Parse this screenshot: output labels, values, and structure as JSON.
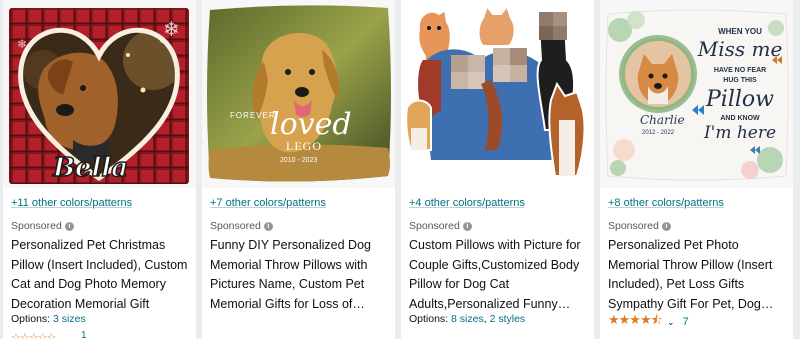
{
  "products": [
    {
      "colors_link": "+11 other colors/patterns",
      "sponsored": "Sponsored",
      "title": "Personalized Pet Christmas Pillow (Insert Included), Custom Cat and Dog Photo Memory Decoration Memorial Gift",
      "options_label": "Options:",
      "options_links": [
        "3 sizes"
      ],
      "image_text": "Bella",
      "partial_rating_count": "1"
    },
    {
      "colors_link": "+7 other colors/patterns",
      "sponsored": "Sponsored",
      "title": "Funny DIY Personalized Dog Memorial Throw Pillows with Pictures Name, Custom Pet Memorial Gifts for Loss of Dogs…",
      "image_text_forever": "FOREVER",
      "image_text_loved": "loved",
      "image_text_name": "LEGO",
      "image_text_years": "2010 - 2023"
    },
    {
      "colors_link": "+4 other colors/patterns",
      "sponsored": "Sponsored",
      "title": "Custom Pillows with Picture for Couple Gifts,Customized Body Pillow for Dog Cat Adults,Personalized Funny…",
      "options_label": "Options:",
      "options_links": [
        "8 sizes",
        "2 styles"
      ]
    },
    {
      "colors_link": "+8 other colors/patterns",
      "sponsored": "Sponsored",
      "title": "Personalized Pet Photo Memorial Throw Pillow (Insert Included), Pet Loss Gifts Sympathy Gift For Pet, Dog Memorial Gift For Los…",
      "rating_value": 4.5,
      "rating_count": "7",
      "image_text_lines": [
        "WHEN YOU",
        "Miss me",
        "HAVE NO FEAR",
        "HUG THIS",
        "Pillow",
        "AND KNOW",
        "I'm here"
      ],
      "image_text_name": "Charlie",
      "image_text_years": "2012 - 2022"
    }
  ],
  "colors": {
    "link": "#007185",
    "star": "#de7921",
    "plaid_red": "#b3202a",
    "background": "#eaeded"
  }
}
